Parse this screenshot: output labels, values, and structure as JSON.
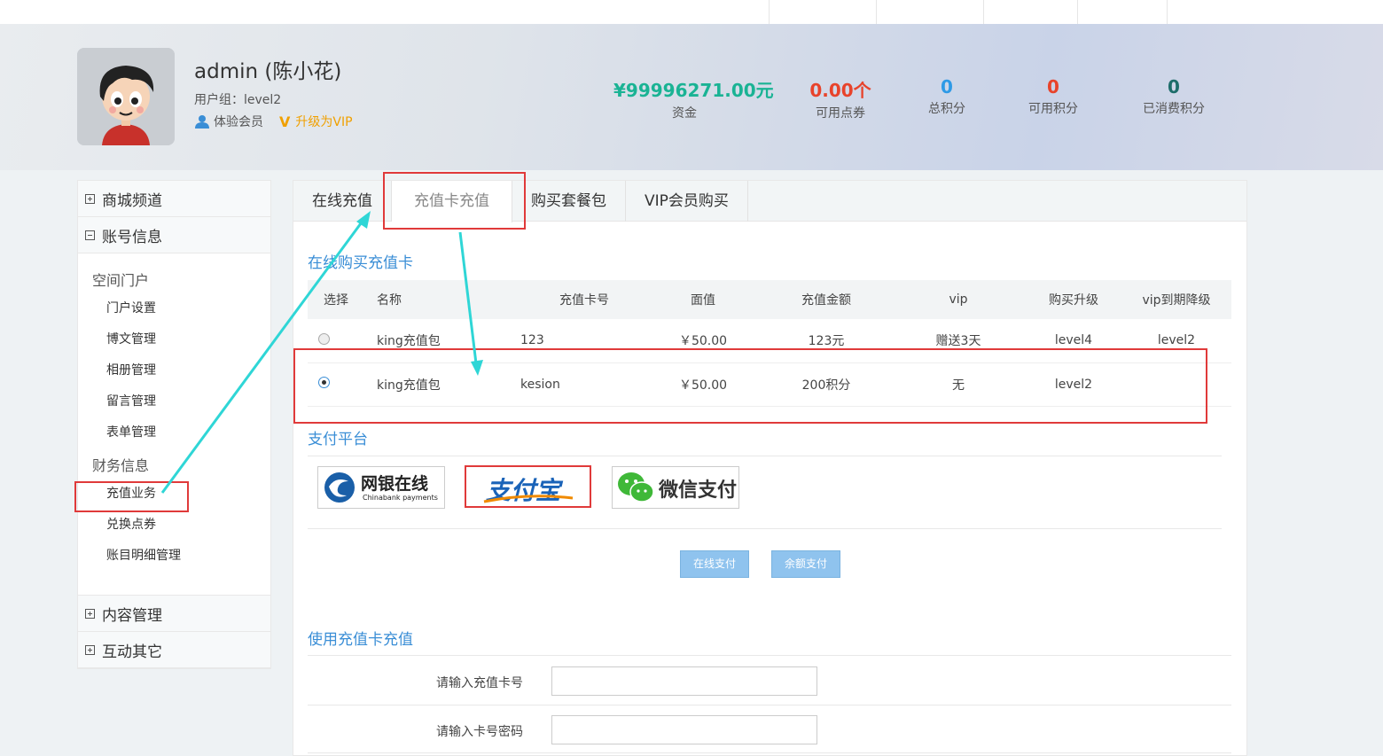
{
  "header": {
    "username": "admin (陈小花)",
    "user_group": "用户组：level2",
    "member_type": "体验会员",
    "upgrade_link": "升级为VIP",
    "stats": [
      {
        "value": "¥99996271.00元",
        "label": "资金",
        "color": "#1ab394"
      },
      {
        "value": "0.00个",
        "label": "可用点券",
        "color": "#e8432b"
      },
      {
        "value": "0",
        "label": "总积分",
        "color": "#2e9ae6"
      },
      {
        "value": "0",
        "label": "可用积分",
        "color": "#e8432b"
      },
      {
        "value": "0",
        "label": "已消费积分",
        "color": "#1d6d6a"
      }
    ]
  },
  "sidebar": {
    "sections": [
      {
        "label": "商城频道",
        "expanded": false
      },
      {
        "label": "账号信息",
        "expanded": true
      },
      {
        "label": "内容管理",
        "expanded": false
      },
      {
        "label": "互动其它",
        "expanded": false
      }
    ],
    "group1": "空间门户",
    "group1_items": [
      "门户设置",
      "博文管理",
      "相册管理",
      "留言管理",
      "表单管理"
    ],
    "group2": "财务信息",
    "group2_items": [
      "充值业务",
      "兑换点券",
      "账目明细管理"
    ]
  },
  "tabs": [
    {
      "label": "在线充值"
    },
    {
      "label": "充值卡充值"
    },
    {
      "label": "购买套餐包"
    },
    {
      "label": "VIP会员购买"
    }
  ],
  "buy_section": {
    "title": "在线购买充值卡",
    "columns": [
      "选择",
      "名称",
      "充值卡号",
      "面值",
      "充值金额",
      "vip",
      "购买升级",
      "vip到期降级"
    ],
    "rows": [
      {
        "selected": false,
        "name": "king充值包",
        "card": "123",
        "face": "￥50.00",
        "amount": "123元",
        "vip": "赠送3天",
        "upgrade": "level4",
        "downgrade": "level2"
      },
      {
        "selected": true,
        "name": "king充值包",
        "card": "kesion",
        "face": "￥50.00",
        "amount": "200积分",
        "vip": "无",
        "upgrade": "level2",
        "downgrade": ""
      }
    ]
  },
  "pay_section": {
    "title": "支付平台",
    "platforms": [
      {
        "name": "网银在线",
        "sub": "Chinabank payments",
        "icon": "chinabank-logo"
      },
      {
        "name": "支付宝",
        "icon": "alipay-logo"
      },
      {
        "name": "微信支付",
        "icon": "wechat-pay-logo"
      }
    ],
    "btn_online": "在线支付",
    "btn_balance": "余额支付"
  },
  "card_section": {
    "title": "使用充值卡充值",
    "card_label": "请输入充值卡号",
    "pwd_label": "请输入卡号密码",
    "card_value": "",
    "pwd_value": ""
  }
}
